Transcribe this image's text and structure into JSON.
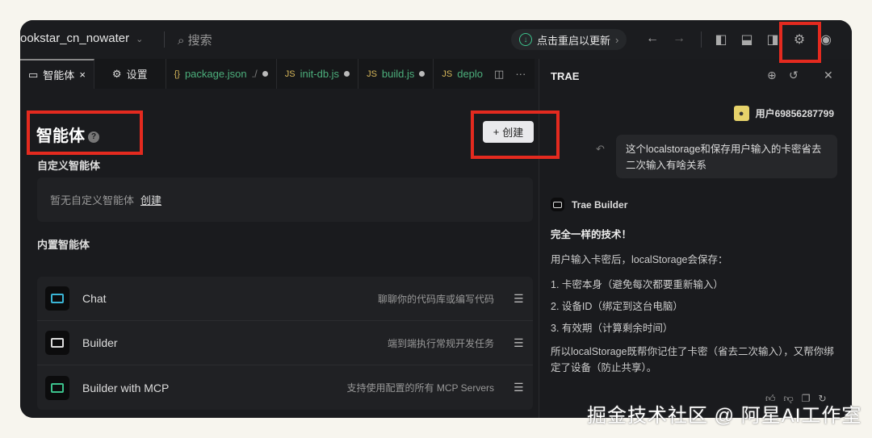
{
  "titlebar": {
    "project": "ookstar_cn_nowater",
    "search": "搜索",
    "update": "点击重启以更新"
  },
  "tabs": [
    {
      "label": "智能体"
    },
    {
      "label": "设置"
    },
    {
      "label": "package.json",
      "suffix": "./"
    },
    {
      "label": "init-db.js"
    },
    {
      "label": "build.js"
    },
    {
      "label": "deplo"
    }
  ],
  "agents": {
    "title": "智能体",
    "create": "创建",
    "custom_heading": "自定义智能体",
    "custom_empty": "暂无自定义智能体",
    "custom_create_link": "创建",
    "builtin_heading": "内置智能体",
    "items": [
      {
        "name": "Chat",
        "desc": "聊聊你的代码库或编写代码",
        "color": "#3ab5d6"
      },
      {
        "name": "Builder",
        "desc": "端到端执行常规开发任务",
        "color": "#dddddd"
      },
      {
        "name": "Builder with MCP",
        "desc": "支持使用配置的所有 MCP Servers",
        "color": "#3cc28c"
      }
    ]
  },
  "chat": {
    "title": "TRAE",
    "user": "用户69856287799",
    "question": "这个localstorage和保存用户输入的卡密省去二次输入有啥关系",
    "bot": "Trae Builder",
    "lines": [
      "完全一样的技术！",
      "用户输入卡密后，localStorage会保存：",
      "1. 卡密本身（避免每次都要重新输入）",
      "2. 设备ID（绑定到这台电脑）",
      "3. 有效期（计算剩余时间）",
      "所以localStorage既帮你记住了卡密（省去二次输入），又帮你绑定了设备（防止共享）。"
    ]
  },
  "watermark": "掘金技术社区 @ 阿星AI工作室"
}
